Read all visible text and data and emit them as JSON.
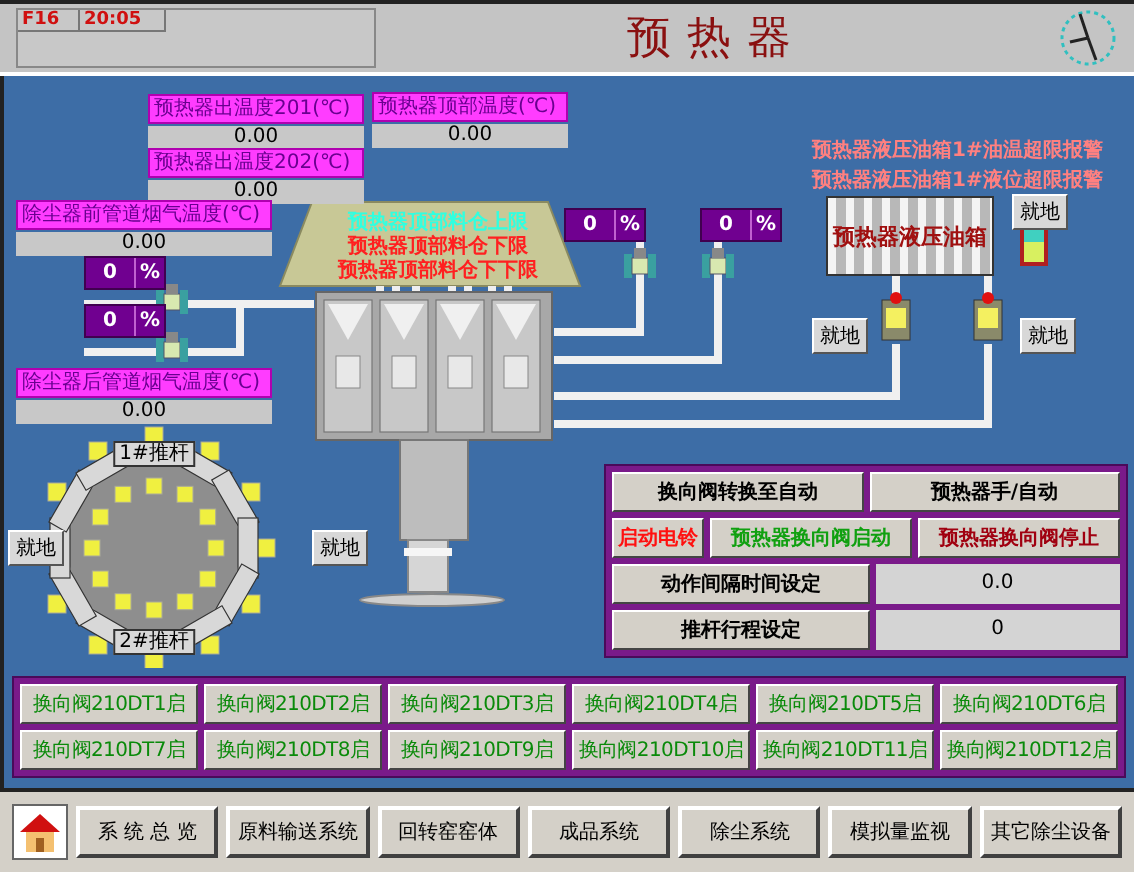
{
  "header": {
    "status_cells": [
      "F16",
      "20:05"
    ],
    "title": "预热器"
  },
  "outlet_temps": [
    {
      "label": "预热器出温度201(℃)",
      "value": "0.00"
    },
    {
      "label": "预热器出温度202(℃)",
      "value": "0.00"
    }
  ],
  "top_temp": {
    "label": "预热器顶部温度(℃)",
    "value": "0.00"
  },
  "duct_temps": [
    {
      "label": "除尘器前管道烟气温度(℃)",
      "value": "0.00"
    },
    {
      "label": "除尘器后管道烟气温度(℃)",
      "value": "0.00"
    }
  ],
  "silo_levels": [
    {
      "text": "预热器顶部料仓上限",
      "kind": "upper"
    },
    {
      "text": "预热器顶部料仓下限",
      "kind": "lower"
    },
    {
      "text": "预热器顶部料仓下下限",
      "kind": "lower"
    }
  ],
  "dampers": [
    {
      "value": "0",
      "unit": "%"
    },
    {
      "value": "0",
      "unit": "%"
    },
    {
      "value": "0",
      "unit": "%"
    },
    {
      "value": "0",
      "unit": "%"
    }
  ],
  "alarms": [
    "预热器液压油箱1#油温超限报警",
    "预热器液压油箱1#液位超限报警"
  ],
  "oil_tank": {
    "label": "预热器液压油箱"
  },
  "local_labels": [
    "就地",
    "就地",
    "就地",
    "就地",
    "就地"
  ],
  "pushers": [
    {
      "label": "1#推杆"
    },
    {
      "label": "2#推杆"
    }
  ],
  "valves": [
    "换向阀210DT1启",
    "换向阀210DT2启",
    "换向阀210DT3启",
    "换向阀210DT4启",
    "换向阀210DT5启",
    "换向阀210DT6启",
    "换向阀210DT7启",
    "换向阀210DT8启",
    "换向阀210DT9启",
    "换向阀210DT10启",
    "换向阀210DT11启",
    "换向阀210DT12启"
  ],
  "control_panel": {
    "mode_buttons": [
      "换向阀转换至自动",
      "预热器手/自动"
    ],
    "action_buttons": [
      {
        "label": "启动电铃",
        "kind": "bell"
      },
      {
        "label": "预热器换向阀启动",
        "kind": "start"
      },
      {
        "label": "预热器换向阀停止",
        "kind": "stop"
      }
    ],
    "settings": [
      {
        "label": "动作间隔时间设定",
        "value": "0.0"
      },
      {
        "label": "推杆行程设定",
        "value": "0"
      }
    ]
  },
  "nav": {
    "items": [
      "系 统 总 览",
      "原料输送系统",
      "回转窑窑体",
      "成品系统",
      "除尘系统",
      "模拟量监视",
      "其它除尘设备"
    ]
  }
}
